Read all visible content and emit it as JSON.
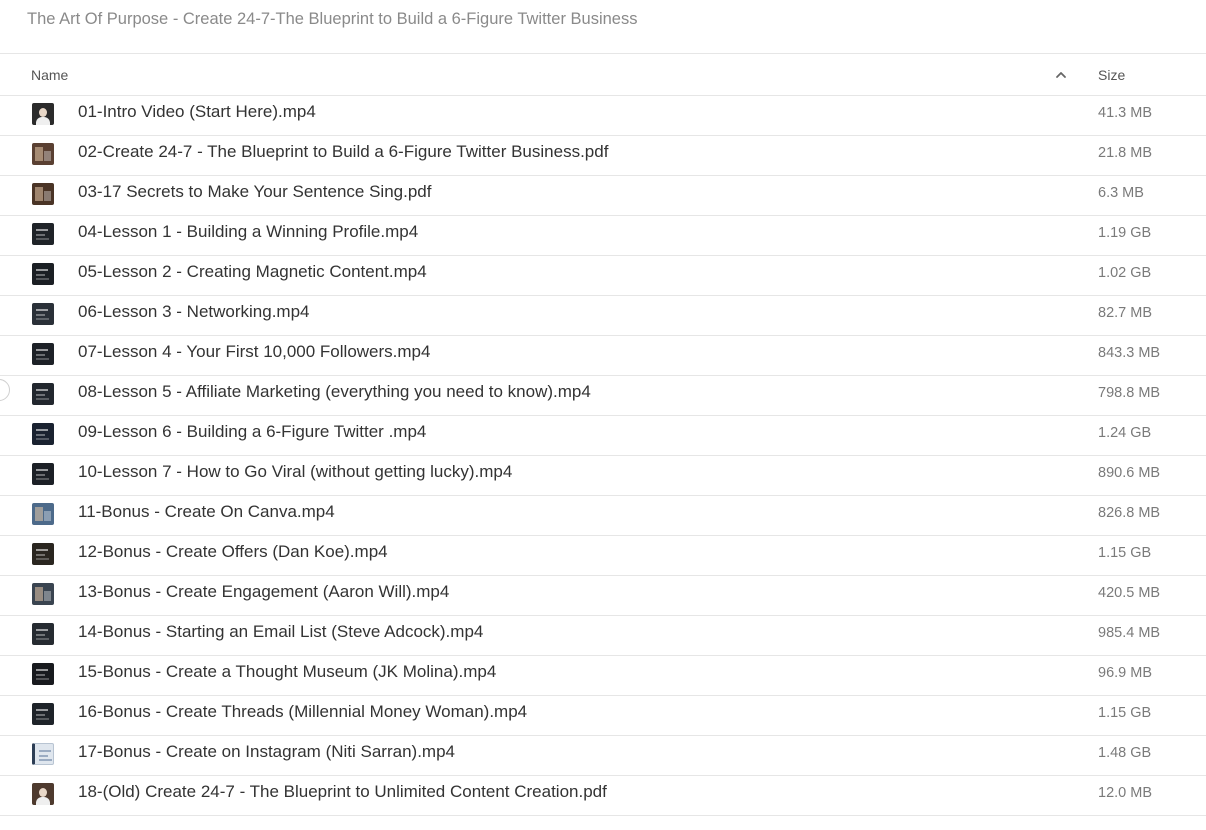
{
  "title": "The Art Of Purpose - Create 24-7-The Blueprint to Build a 6-Figure Twitter Business",
  "columns": {
    "name": "Name",
    "size": "Size",
    "sort_icon": "chevron-up-icon"
  },
  "files": [
    {
      "name": "01-Intro Video (Start Here).mp4",
      "size": "41.3 MB",
      "thumb_color": "#2b2b2b",
      "thumb_style": "portrait"
    },
    {
      "name": "02-Create 24-7 - The Blueprint to Build a 6-Figure Twitter Business.pdf",
      "size": "21.8 MB",
      "thumb_color": "#5a4032",
      "thumb_style": "photo"
    },
    {
      "name": "03-17 Secrets to Make Your Sentence Sing.pdf",
      "size": "6.3 MB",
      "thumb_color": "#4a3426",
      "thumb_style": "photo"
    },
    {
      "name": "04-Lesson 1 - Building a Winning Profile.mp4",
      "size": "1.19 GB",
      "thumb_color": "#1f2328",
      "thumb_style": "screen"
    },
    {
      "name": "05-Lesson 2 - Creating Magnetic Content.mp4",
      "size": "1.02 GB",
      "thumb_color": "#1b1f24",
      "thumb_style": "screen"
    },
    {
      "name": "06-Lesson 3 - Networking.mp4",
      "size": "82.7 MB",
      "thumb_color": "#2a3038",
      "thumb_style": "screen"
    },
    {
      "name": "07-Lesson 4 - Your First 10,000 Followers.mp4",
      "size": "843.3 MB",
      "thumb_color": "#1d2127",
      "thumb_style": "screen"
    },
    {
      "name": "08-Lesson 5 - Affiliate Marketing (everything you need to know).mp4",
      "size": "798.8 MB",
      "thumb_color": "#22272e",
      "thumb_style": "screen"
    },
    {
      "name": "09-Lesson 6 - Building a 6-Figure Twitter .mp4",
      "size": "1.24 GB",
      "thumb_color": "#1a2230",
      "thumb_style": "screen"
    },
    {
      "name": "10-Lesson 7 - How to Go Viral (without getting lucky).mp4",
      "size": "890.6 MB",
      "thumb_color": "#1c2026",
      "thumb_style": "screen"
    },
    {
      "name": "11-Bonus - Create On Canva.mp4",
      "size": "826.8 MB",
      "thumb_color": "#4d6a8a",
      "thumb_style": "photo"
    },
    {
      "name": "12-Bonus - Create Offers (Dan Koe).mp4",
      "size": "1.15 GB",
      "thumb_color": "#2a2620",
      "thumb_style": "screen"
    },
    {
      "name": "13-Bonus - Create Engagement (Aaron Will).mp4",
      "size": "420.5 MB",
      "thumb_color": "#3a4450",
      "thumb_style": "photo"
    },
    {
      "name": "14-Bonus - Starting an Email List (Steve Adcock).mp4",
      "size": "985.4 MB",
      "thumb_color": "#262b31",
      "thumb_style": "screen"
    },
    {
      "name": "15-Bonus - Create a Thought Museum (JK Molina).mp4",
      "size": "96.9 MB",
      "thumb_color": "#181a1e",
      "thumb_style": "screen"
    },
    {
      "name": "16-Bonus - Create Threads (Millennial Money Woman).mp4",
      "size": "1.15 GB",
      "thumb_color": "#1e2329",
      "thumb_style": "screen"
    },
    {
      "name": "17-Bonus - Create on Instagram (Niti Sarran).mp4",
      "size": "1.48 GB",
      "thumb_color": "#dfe6ee",
      "thumb_style": "light"
    },
    {
      "name": "18-(Old) Create 24-7 - The Blueprint to Unlimited Content Creation.pdf",
      "size": "12.0 MB",
      "thumb_color": "#4e3a2e",
      "thumb_style": "portrait"
    }
  ]
}
